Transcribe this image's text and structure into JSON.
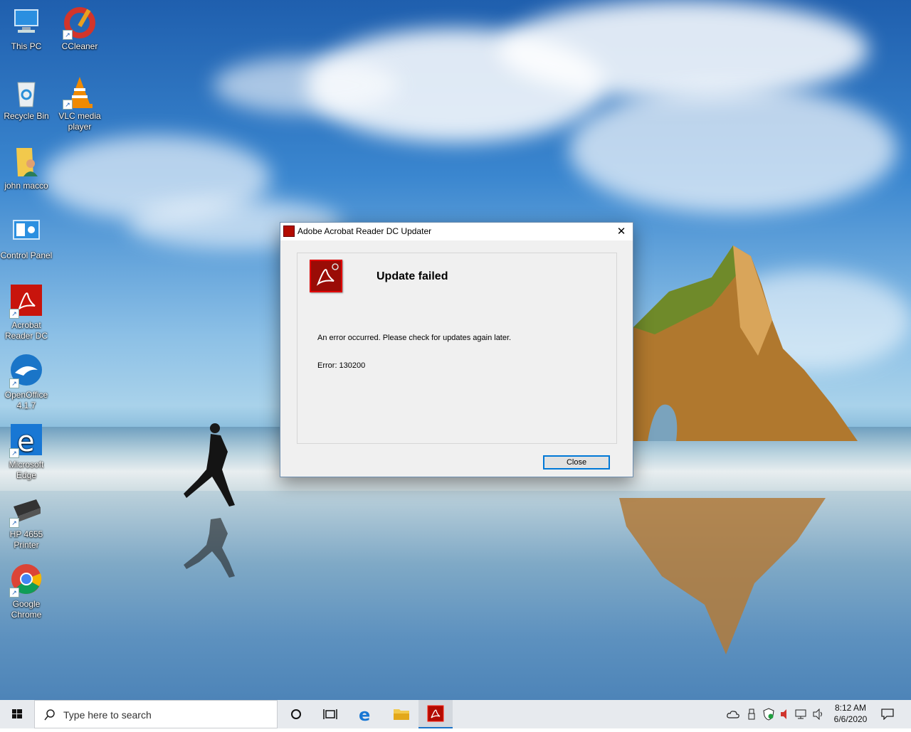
{
  "desktop": {
    "icons": [
      {
        "label": "This PC"
      },
      {
        "label": "CCleaner"
      },
      {
        "label": "Recycle Bin"
      },
      {
        "label": "VLC media player"
      },
      {
        "label": "john macco"
      },
      {
        "label": "Control Panel"
      },
      {
        "label": "Acrobat Reader DC"
      },
      {
        "label": "OpenOffice 4.1.7"
      },
      {
        "label": "Microsoft Edge"
      },
      {
        "label": "HP 4655 Printer"
      },
      {
        "label": "Google Chrome"
      }
    ]
  },
  "dialog": {
    "title": "Adobe Acrobat Reader DC Updater",
    "heading": "Update failed",
    "message": "An error occurred. Please check for updates again later.",
    "error": "Error: 130200",
    "close_button": "Close",
    "close_glyph": "✕"
  },
  "taskbar": {
    "search_placeholder": "Type here to search",
    "time": "8:12 AM",
    "date": "6/6/2020",
    "accent": "#1a73c8"
  }
}
